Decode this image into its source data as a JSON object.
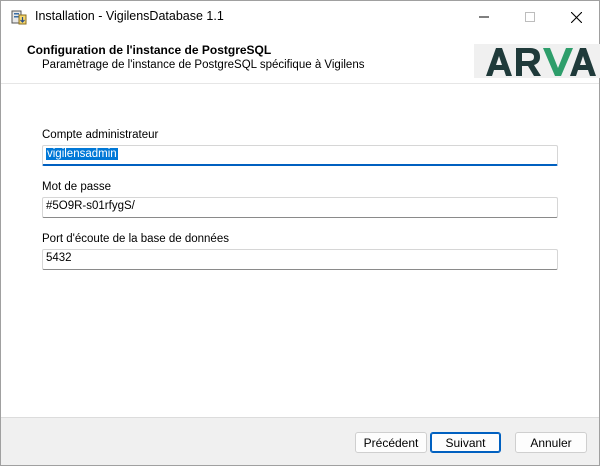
{
  "window": {
    "title": "Installation - VigilensDatabase 1.1"
  },
  "header": {
    "title": "Configuration de l'instance de PostgreSQL",
    "subtitle": "Paramètrage de l'instance de PostgreSQL spécifique à Vigilens",
    "logo_text": "ARVA",
    "logo_color": "#1f3a3a",
    "logo_accent": "#2e9e6b"
  },
  "form": {
    "admin_label": "Compte administrateur",
    "admin_value": "vigilensadmin",
    "password_label": "Mot de passe",
    "password_value": "#5O9R-s01rfygS/",
    "port_label": "Port d'écoute de la base de données",
    "port_value": "5432"
  },
  "buttons": {
    "back_label": "Précédent",
    "next_label": "Suivant",
    "cancel_label": "Annuler"
  },
  "colors": {
    "accent": "#0078d7",
    "focus_border": "#0060c0",
    "footer_bg": "#f0f0f0"
  }
}
